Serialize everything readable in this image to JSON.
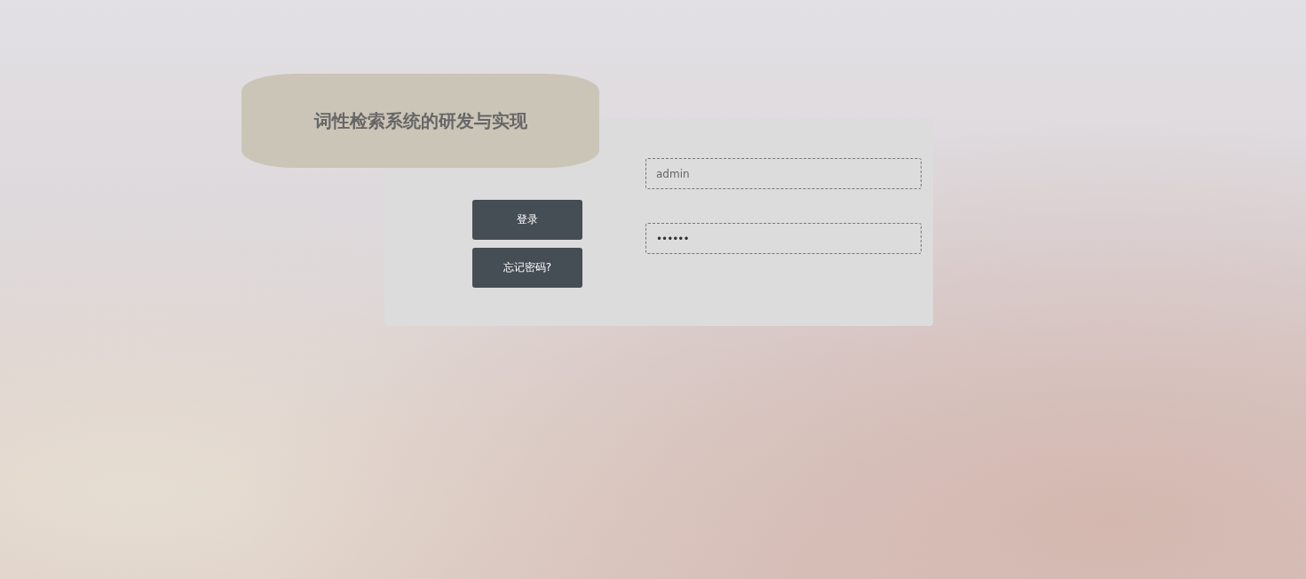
{
  "title": "词性检索系统的研发与实现",
  "buttons": [
    {
      "label": "登录"
    },
    {
      "label": "忘记密码?"
    }
  ],
  "fields": [
    {
      "kind": "text",
      "value": "admin"
    },
    {
      "kind": "password",
      "value": "••••••"
    }
  ]
}
